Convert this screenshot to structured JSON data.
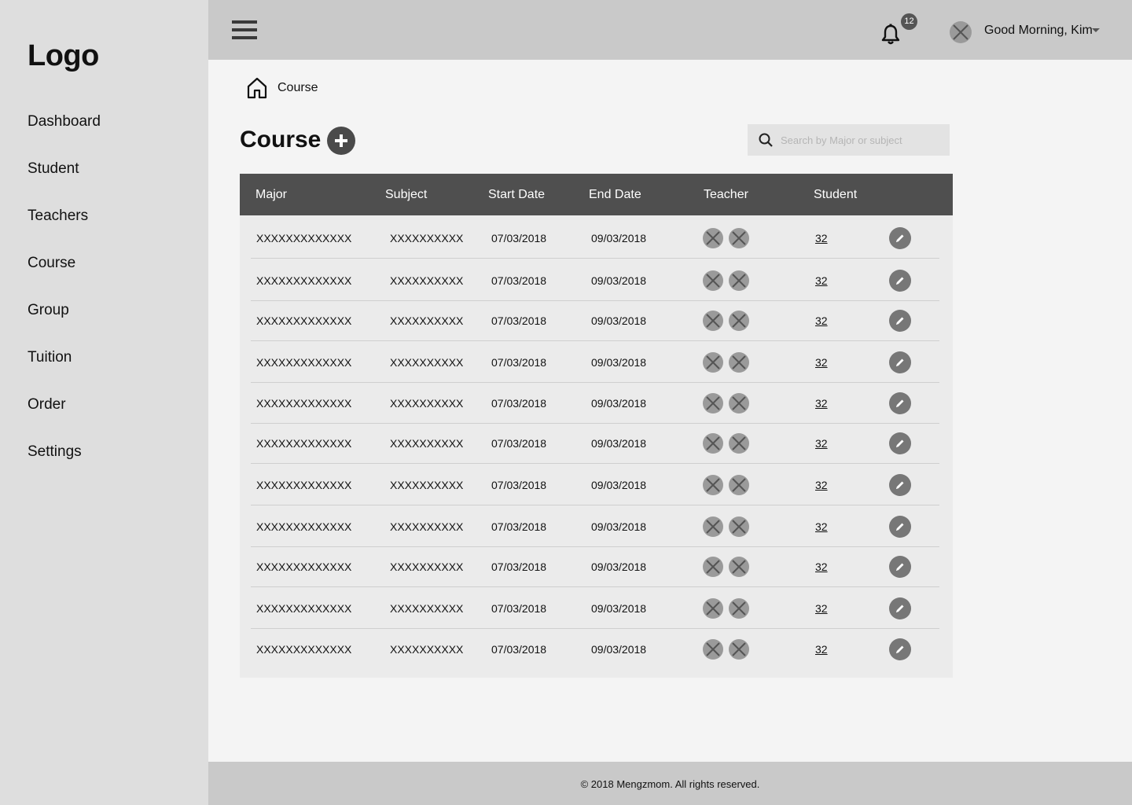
{
  "sidebar": {
    "logo": "Logo",
    "items": [
      {
        "label": "Dashboard"
      },
      {
        "label": "Student"
      },
      {
        "label": "Teachers"
      },
      {
        "label": "Course"
      },
      {
        "label": "Group"
      },
      {
        "label": "Tuition"
      },
      {
        "label": "Order"
      },
      {
        "label": "Settings"
      }
    ]
  },
  "header": {
    "notification_count": "12",
    "greeting": "Good Morning, Kim"
  },
  "breadcrumb": {
    "current": "Course"
  },
  "main": {
    "title": "Course",
    "search": {
      "placeholder": "Search by Major or subject",
      "value": ""
    }
  },
  "table": {
    "columns": [
      "Major",
      "Subject",
      "Start Date",
      "End Date",
      "Teacher",
      "Student"
    ],
    "rows": [
      {
        "major": "XXXXXXXXXXXXX",
        "subject": "XXXXXXXXXX",
        "start": "07/03/2018",
        "end": "09/03/2018",
        "students": "32"
      },
      {
        "major": "XXXXXXXXXXXXX",
        "subject": "XXXXXXXXXX",
        "start": "07/03/2018",
        "end": "09/03/2018",
        "students": "32"
      },
      {
        "major": "XXXXXXXXXXXXX",
        "subject": "XXXXXXXXXX",
        "start": "07/03/2018",
        "end": "09/03/2018",
        "students": "32"
      },
      {
        "major": "XXXXXXXXXXXXX",
        "subject": "XXXXXXXXXX",
        "start": "07/03/2018",
        "end": "09/03/2018",
        "students": "32"
      },
      {
        "major": "XXXXXXXXXXXXX",
        "subject": "XXXXXXXXXX",
        "start": "07/03/2018",
        "end": "09/03/2018",
        "students": "32"
      },
      {
        "major": "XXXXXXXXXXXXX",
        "subject": "XXXXXXXXXX",
        "start": "07/03/2018",
        "end": "09/03/2018",
        "students": "32"
      },
      {
        "major": "XXXXXXXXXXXXX",
        "subject": "XXXXXXXXXX",
        "start": "07/03/2018",
        "end": "09/03/2018",
        "students": "32"
      },
      {
        "major": "XXXXXXXXXXXXX",
        "subject": "XXXXXXXXXX",
        "start": "07/03/2018",
        "end": "09/03/2018",
        "students": "32"
      },
      {
        "major": "XXXXXXXXXXXXX",
        "subject": "XXXXXXXXXX",
        "start": "07/03/2018",
        "end": "09/03/2018",
        "students": "32"
      },
      {
        "major": "XXXXXXXXXXXXX",
        "subject": "XXXXXXXXXX",
        "start": "07/03/2018",
        "end": "09/03/2018",
        "students": "32"
      },
      {
        "major": "XXXXXXXXXXXXX",
        "subject": "XXXXXXXXXX",
        "start": "07/03/2018",
        "end": "09/03/2018",
        "students": "32"
      }
    ]
  },
  "footer": {
    "copyright": "© 2018 Mengzmom. All rights reserved."
  },
  "icons": {
    "menu": "hamburger-icon",
    "notification": "bell-icon",
    "avatar": "avatar-placeholder-icon",
    "home": "home-icon",
    "add": "plus-circle-icon",
    "search": "search-icon",
    "edit": "pencil-icon"
  }
}
